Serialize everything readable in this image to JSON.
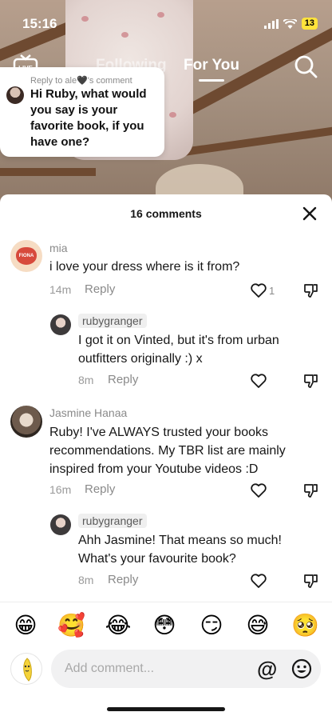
{
  "status": {
    "time": "15:16",
    "battery": "13"
  },
  "nav": {
    "following": "Following",
    "for_you": "For You"
  },
  "reply_bubble": {
    "caption": "Reply to ale🖤's comment",
    "text": "Hi Ruby, what would you say is your favorite book, if you have one?"
  },
  "sheet": {
    "title": "16 comments"
  },
  "comments": [
    {
      "user": "mia",
      "text": "i love your dress where is it from?",
      "time": "14m",
      "reply": "Reply",
      "likes": "1"
    },
    {
      "user": "rubygranger",
      "text": "I got it on Vinted, but it's from urban outfitters originally :) x",
      "time": "8m",
      "reply": "Reply"
    },
    {
      "user": "Jasmine Hanaa",
      "text": "Ruby! I've ALWAYS trusted your books recommendations. My TBR list are mainly inspired from your Youtube videos :D",
      "time": "16m",
      "reply": "Reply"
    },
    {
      "user": "rubygranger",
      "text": "Ahh Jasmine! That means so much! What's your favourite book?",
      "time": "8m",
      "reply": "Reply"
    }
  ],
  "emojis": [
    "😁",
    "🥰",
    "😂",
    "😳",
    "😏",
    "😅",
    "🥺"
  ],
  "input": {
    "placeholder": "Add comment...",
    "at_symbol": "@"
  },
  "mia_avatar_text": "FIONA",
  "colors": {
    "accent_pill": "#efefef",
    "text_primary": "#161616",
    "text_secondary": "#8a8a8a"
  }
}
